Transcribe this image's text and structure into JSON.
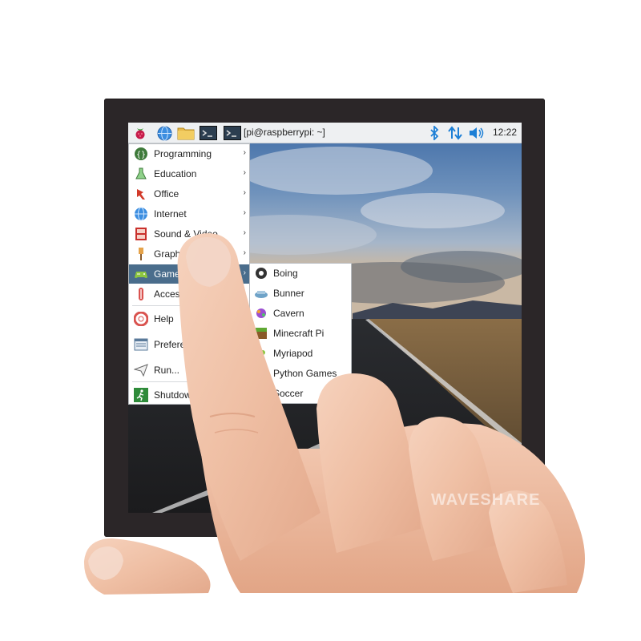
{
  "taskbar": {
    "terminal_title": "[pi@raspberrypi: ~]",
    "clock": "12:22",
    "icons": [
      "raspberry-menu-icon",
      "web-browser-icon",
      "file-manager-icon",
      "terminal-icon",
      "bluetooth-icon",
      "network-icon",
      "volume-icon"
    ]
  },
  "menu": {
    "items": [
      {
        "label": "Programming",
        "icon": "programming-icon",
        "has_submenu": true
      },
      {
        "label": "Education",
        "icon": "education-icon",
        "has_submenu": true
      },
      {
        "label": "Office",
        "icon": "office-icon",
        "has_submenu": true
      },
      {
        "label": "Internet",
        "icon": "internet-icon",
        "has_submenu": true
      },
      {
        "label": "Sound & Video",
        "icon": "sound-video-icon",
        "has_submenu": true
      },
      {
        "label": "Graphics",
        "icon": "graphics-icon",
        "has_submenu": true
      },
      {
        "label": "Games",
        "icon": "games-icon",
        "has_submenu": true,
        "selected": true
      },
      {
        "label": "Accessories",
        "icon": "accessories-icon",
        "has_submenu": true
      },
      {
        "label": "Help",
        "icon": "help-icon",
        "has_submenu": true
      },
      {
        "label": "Preferences",
        "icon": "preferences-icon",
        "has_submenu": true
      },
      {
        "label": "Run...",
        "icon": "run-icon",
        "has_submenu": false
      },
      {
        "label": "Shutdown...",
        "icon": "shutdown-icon",
        "has_submenu": false
      }
    ]
  },
  "games_submenu": {
    "items": [
      {
        "label": "Boing",
        "icon": "boing-icon"
      },
      {
        "label": "Bunner",
        "icon": "bunner-icon"
      },
      {
        "label": "Cavern",
        "icon": "cavern-icon"
      },
      {
        "label": "Minecraft Pi",
        "icon": "minecraft-icon"
      },
      {
        "label": "Myriapod",
        "icon": "myriapod-icon"
      },
      {
        "label": "Python Games",
        "icon": "python-games-icon"
      },
      {
        "label": "Soccer",
        "icon": "soccer-icon"
      }
    ]
  },
  "watermark": "WAVESHARE",
  "colors": {
    "selection": "#4a6d8c",
    "bezel": "#2b2628",
    "taskbar": "#eef0f2",
    "accent_blue": "#1c7fd6"
  }
}
